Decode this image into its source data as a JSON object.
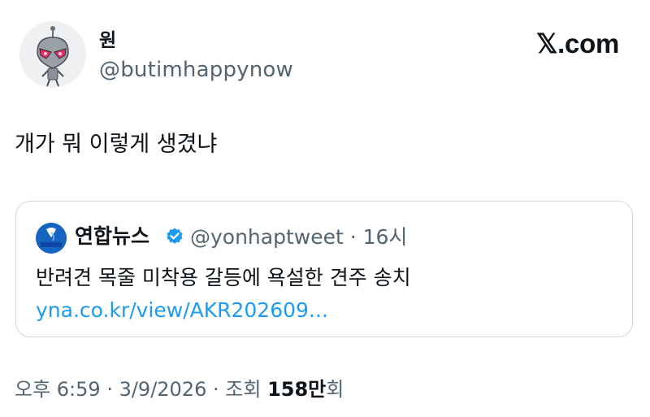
{
  "tweet": {
    "author": {
      "name": "원",
      "handle": "@butimhappynow"
    },
    "brand": "𝕏.com",
    "text": "개가 뭐 이렇게 생겼냐",
    "quoted": {
      "name": "연합뉴스",
      "handle": "@yonhaptweet · 16시",
      "text": "반려견 목줄 미착용 갈등에 욕설한 견주 송치",
      "link": "yna.co.kr/view/AKR202609...",
      "avatar_label": "연합뉴스",
      "brand_color": "#1565c0",
      "verified_color": "#1d9bf0"
    },
    "meta": {
      "time": "오후 6:59",
      "sep1": " · ",
      "date": "3/9/2026",
      "sep2": " · ",
      "views_label": "조회 ",
      "views_count": "158만",
      "views_unit": "회"
    }
  }
}
